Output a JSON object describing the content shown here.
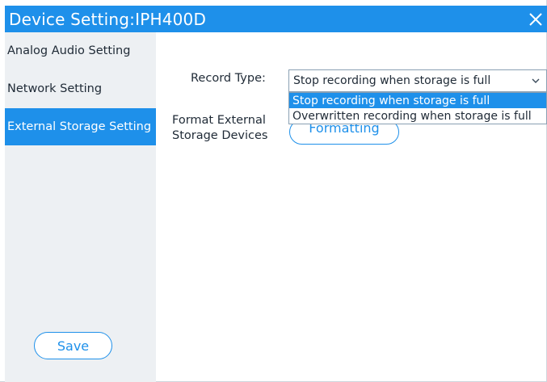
{
  "window": {
    "title": "Device Setting:IPH400D",
    "accent_color": "#1e90ea"
  },
  "sidebar": {
    "items": [
      {
        "label": "Analog Audio Setting",
        "active": false
      },
      {
        "label": "Network Setting",
        "active": false
      },
      {
        "label": "External Storage Setting",
        "active": true
      }
    ],
    "save_label": "Save"
  },
  "main": {
    "record_type_label": "Record Type:",
    "record_type_value": "Stop recording when storage is full",
    "record_type_options": [
      "Stop recording when storage is full",
      "Overwritten recording when storage is full"
    ],
    "format_label_line1": "Format External",
    "format_label_line2": "Storage Devices",
    "format_button_label": "Formatting"
  },
  "icons": {
    "close": "close-icon",
    "dropdown": "chevron-down-icon"
  }
}
